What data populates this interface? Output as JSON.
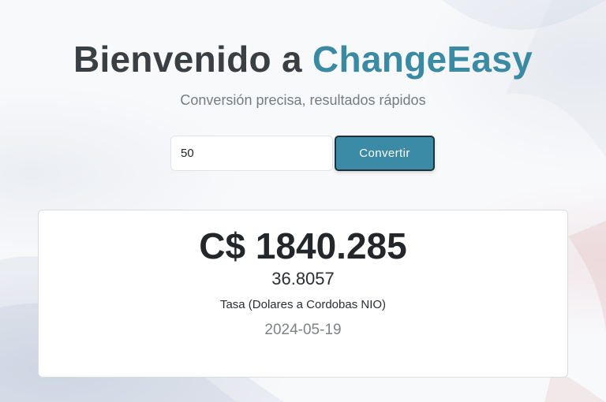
{
  "header": {
    "title_prefix": "Bienvenido a ",
    "title_brand": "ChangeEasy",
    "subtitle": "Conversión precisa, resultados rápidos"
  },
  "converter": {
    "amount_value": "50",
    "convert_label": "Convertir"
  },
  "result": {
    "converted_amount": "C$ 1840.285",
    "rate": "36.8057",
    "rate_label": "Tasa (Dolares a Cordobas NIO)",
    "date": "2024-05-19"
  },
  "colors": {
    "brand": "#3a8aa3",
    "button": "#3b8aa6",
    "title_text": "#3a3f44"
  }
}
